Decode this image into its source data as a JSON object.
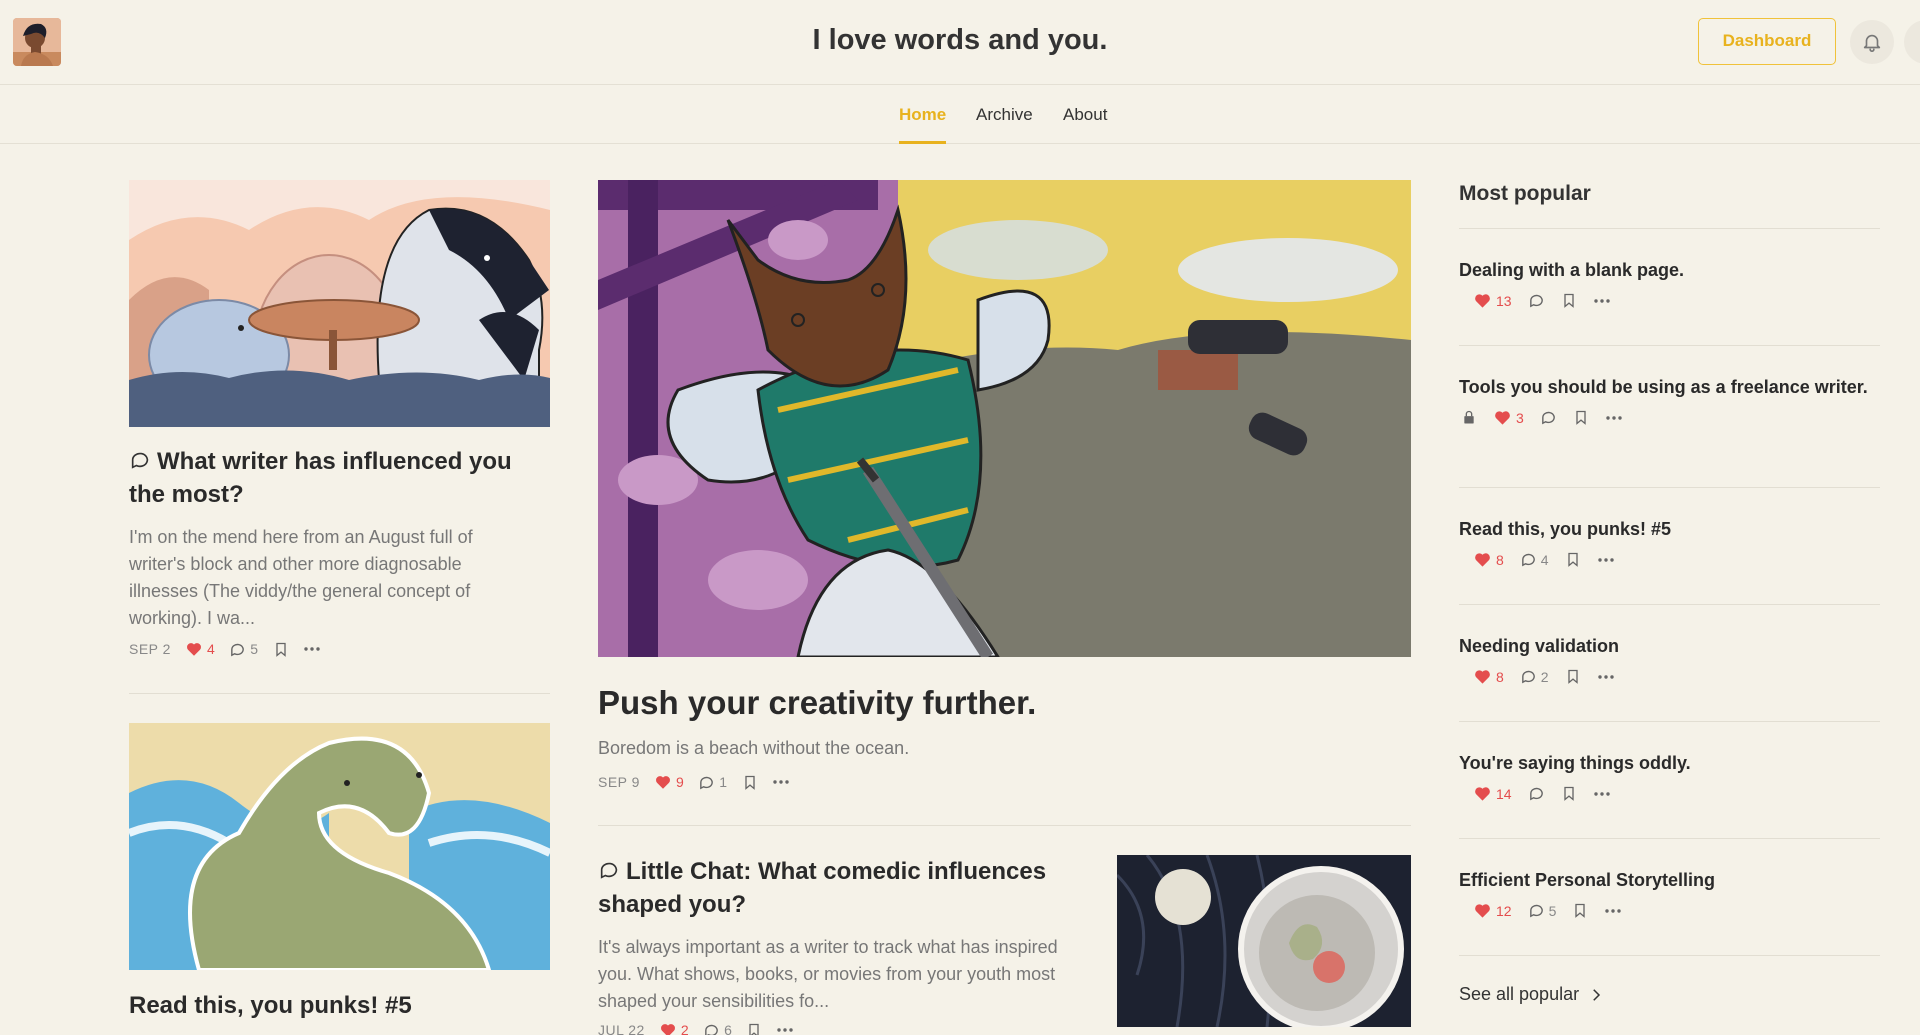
{
  "header": {
    "site_title": "I love words and you.",
    "dashboard_label": "Dashboard"
  },
  "nav": {
    "tabs": [
      {
        "label": "Home",
        "active": true
      },
      {
        "label": "Archive",
        "active": false
      },
      {
        "label": "About",
        "active": false
      }
    ]
  },
  "colors": {
    "accent": "#e8b21e",
    "like": "#e44d4d",
    "background": "#f5f2e8"
  },
  "posts": {
    "left1": {
      "title": "What writer has influenced you the most?",
      "excerpt": "I'm on the mend here from an August full of writer's block and other more diagnosable illnesses (The viddy/the general concept of working). I wa...",
      "date": "SEP 2",
      "likes": "4",
      "comments": "5"
    },
    "left2": {
      "title": "Read this, you punks! #5"
    },
    "featured": {
      "title": "Push your creativity further.",
      "subtitle": "Boredom is a beach without the ocean.",
      "date": "SEP 9",
      "likes": "9",
      "comments": "1"
    },
    "chat": {
      "title": "Little Chat: What comedic influences shaped you?",
      "excerpt": "It's always important as a writer to track what has inspired you. What shows, books, or movies from your youth most shaped your sensibilities fo...",
      "date": "JUL 22",
      "likes": "2",
      "comments": "6"
    }
  },
  "sidebar": {
    "heading": "Most popular",
    "items": [
      {
        "title": "Dealing with a blank page.",
        "likes": "13",
        "comments": ""
      },
      {
        "title": "Tools you should be using as a freelance writer.",
        "likes": "3",
        "comments": "",
        "locked": true
      },
      {
        "title": "Read this, you punks! #5",
        "likes": "8",
        "comments": "4"
      },
      {
        "title": "Needing validation",
        "likes": "8",
        "comments": "2"
      },
      {
        "title": "You're saying things oddly.",
        "likes": "14",
        "comments": ""
      },
      {
        "title": "Efficient Personal Storytelling",
        "likes": "12",
        "comments": "5"
      }
    ],
    "see_all": "See all popular"
  }
}
